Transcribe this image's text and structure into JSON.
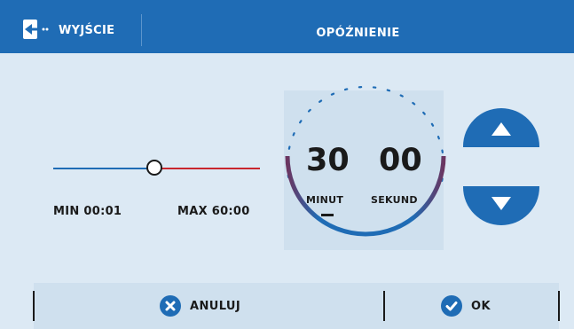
{
  "header": {
    "exit_label": "WYJŚCIE",
    "title": "OPÓŹNIENIE"
  },
  "slider": {
    "min_label": "MIN 00:01",
    "max_label": "MAX 60:00",
    "value_fraction": 0.5
  },
  "time": {
    "minutes": "30",
    "seconds": "00",
    "minutes_label": "MINUT",
    "seconds_label": "SEKUND",
    "selected": "minutes"
  },
  "arrows": {
    "up_icon": "triangle-up-icon",
    "down_icon": "triangle-down-icon"
  },
  "footer": {
    "cancel_label": "ANULUJ",
    "ok_label": "OK"
  },
  "colors": {
    "accent": "#1f6cb5",
    "background": "#dce9f4",
    "slider_right": "#c8262e"
  }
}
